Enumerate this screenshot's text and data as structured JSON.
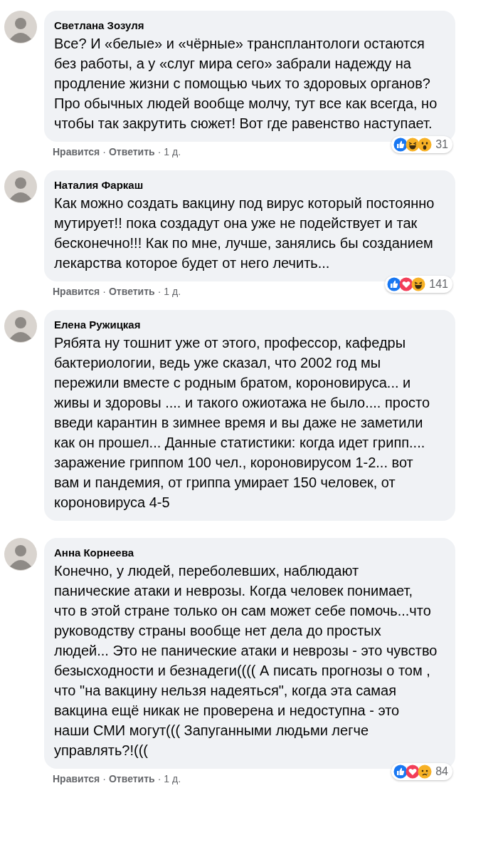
{
  "comments": [
    {
      "author": "Светлана Зозуля",
      "text": "Все? И «белые» и «чёрные» трансплантологи остаются без работы, а у «слуг мира сего» забрали надежду на продление жизни с помощью чьих то здоровых органов? Про обычных людей вообще молчу, тут все как всегда, но чтобы так закрутить сюжет! Вот где равенство наступает.",
      "reactions": [
        {
          "kind": "like"
        },
        {
          "kind": "haha"
        },
        {
          "kind": "wow"
        }
      ],
      "reaction_count": "31",
      "actions": {
        "like": "Нравится",
        "separator_1": "·",
        "reply": "Ответить",
        "separator_2": "·",
        "time": "1 д."
      }
    },
    {
      "author": "Наталия Фаркаш",
      "text": "Как можно создать вакцину под вирус который постоянно мутирует!! пока создадут она уже не подействует и так бесконечно!!! Как по мне, лучше, занялись бы созданием лекарства которое будет от него лечить...",
      "reactions": [
        {
          "kind": "like"
        },
        {
          "kind": "love"
        },
        {
          "kind": "haha"
        }
      ],
      "reaction_count": "141",
      "actions": {
        "like": "Нравится",
        "separator_1": "·",
        "reply": "Ответить",
        "separator_2": "·",
        "time": "1 д."
      }
    },
    {
      "author": "Елена Ружицкая",
      "text": "Рябята ну тошнит уже от этого, профессор, кафедры бактериологии, ведь уже сказал, что 2002 год мы пережили вместе с родным братом, короновируса... и живы и здоровы .... и такого ожиотажа не было.... просто введи карантин в зимнее время и вы даже не заметили как он прошел... Данные статистики: когда идет грипп.... заражение гриппом 100 чел., короновирусом 1-2... вот вам и пандемия, от гриппа умирает 150 человек, от короновируса 4-5"
    },
    {
      "author": "Анна Корнеева",
      "text": "Конечно, у людей, переболевших, наблюдают панические атаки и неврозы. Когда человек понимает, что в этой стране только он сам может себе помочь...что руководству страны вообще нет дела до простых людей... Это не панические атаки и неврозы - это чувство безысходности и безнадеги(((( А писать прогнозы о том , что \"на вакцину нельзя надеяться\", когда эта самая вакцина ещё никак не проверена и недоступна - это наши СМИ могут((( Запуганными людьми легче управлять?!(((",
      "reactions": [
        {
          "kind": "like"
        },
        {
          "kind": "love"
        },
        {
          "kind": "sad"
        }
      ],
      "reaction_count": "84",
      "actions": {
        "like": "Нравится",
        "separator_1": "·",
        "reply": "Ответить",
        "separator_2": "·",
        "time": "1 д."
      }
    }
  ]
}
